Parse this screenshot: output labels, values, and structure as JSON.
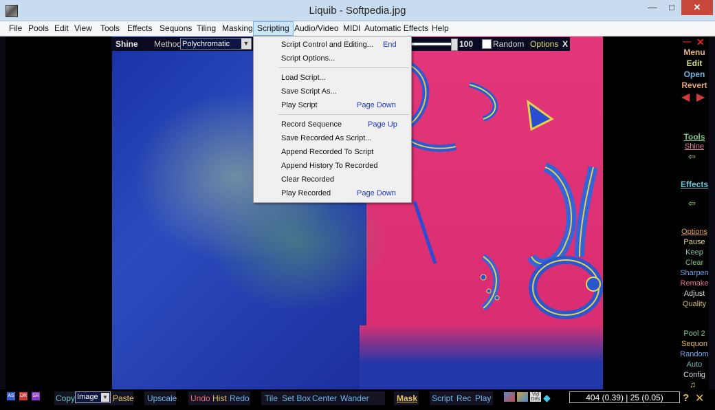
{
  "window": {
    "title": "Liquib - Softpedia.jpg",
    "minimize": "—",
    "maximize": "□",
    "close": "✕"
  },
  "menubar": [
    "File",
    "Pools",
    "Edit",
    "View",
    "Tools",
    "Effects",
    "Sequons",
    "Tiling",
    "Masking",
    "Scripting",
    "Audio/Video",
    "MIDI",
    "Automatic Effects",
    "Help"
  ],
  "shine_bar": {
    "name": "Shine",
    "method_label": "Method",
    "method_value": "Polychromatic",
    "slider_value": "100",
    "random_label": "Random",
    "options_label": "Options",
    "close_label": "X"
  },
  "scripting_menu": {
    "items": [
      {
        "label": "Script Control and Editing...",
        "shortcut": "End"
      },
      {
        "label": "Script Options...",
        "shortcut": ""
      },
      {
        "label": "Load Script...",
        "shortcut": ""
      },
      {
        "label": "Save Script As...",
        "shortcut": ""
      },
      {
        "label": "Play Script",
        "shortcut": "Page Down"
      },
      {
        "label": "Record Sequence",
        "shortcut": "Page Up"
      },
      {
        "label": "Save Recorded As Script...",
        "shortcut": ""
      },
      {
        "label": "Append Recorded To Script",
        "shortcut": ""
      },
      {
        "label": "Append History To Recorded",
        "shortcut": ""
      },
      {
        "label": "Clear Recorded",
        "shortcut": ""
      },
      {
        "label": "Play Recorded",
        "shortcut": "Page Down"
      }
    ]
  },
  "right_panel": {
    "menu": "Menu",
    "edit": "Edit",
    "open": "Open",
    "revert": "Revert",
    "tools": "Tools",
    "shine": "Shine",
    "effects": "Effects",
    "options": "Options",
    "pause": "Pause",
    "keep": "Keep",
    "clear": "Clear",
    "sharpen": "Sharpen",
    "remake": "Remake",
    "adjust": "Adjust",
    "quality": "Quality",
    "pool": "Pool 2",
    "sequon": "Sequon",
    "random": "Random",
    "auto": "Auto",
    "config": "Config"
  },
  "bottom_bar": {
    "icons": [
      "AS",
      "DR",
      "SR"
    ],
    "copy": "Copy",
    "image_select": "Image",
    "paste": "Paste",
    "upscale": "Upscale",
    "undo": "Undo",
    "hist": "Hist",
    "redo": "Redo",
    "tile": "Tile",
    "setbox": "Set Box",
    "center": "Center",
    "wander": "Wander",
    "mask": "Mask",
    "script": "Script",
    "rec": "Rec",
    "play": "Play",
    "status": "404 (0.39) | 25 (0.05)",
    "help": "?"
  },
  "colors": {
    "accent_menu": "#cce4f7",
    "close": "#c7473b",
    "shortcut": "#1a35c4"
  }
}
